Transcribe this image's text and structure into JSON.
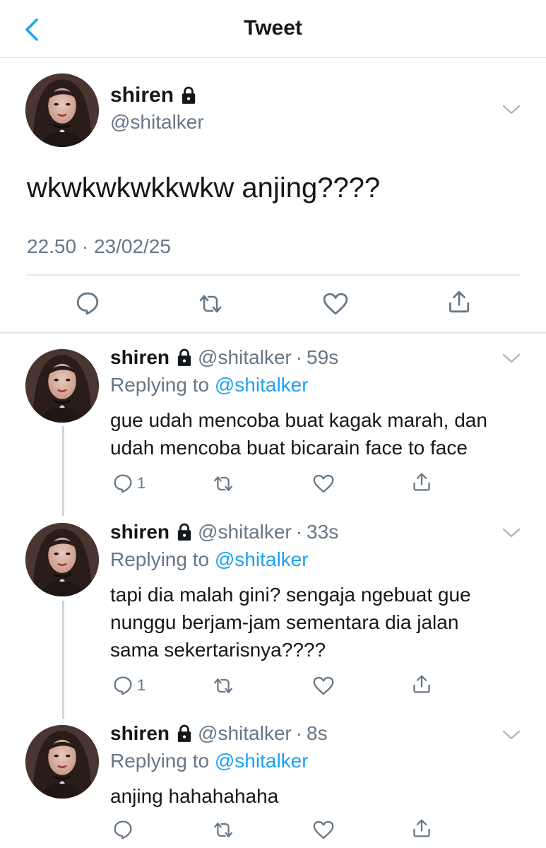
{
  "header": {
    "title": "Tweet"
  },
  "main_tweet": {
    "name": "shiren",
    "handle": "@shitalker",
    "text": "wkwkwkwkkwkw anjing????",
    "timestamp": "22.50 · 23/02/25"
  },
  "replies": [
    {
      "name": "shiren",
      "handle": "@shitalker",
      "separator": "·",
      "age": "59s",
      "replying_prefix": "Replying to ",
      "replying_to": "@shitalker",
      "text": "gue udah mencoba buat kagak marah, dan\nudah mencoba buat bicarain face to face",
      "reply_count": "1"
    },
    {
      "name": "shiren",
      "handle": "@shitalker",
      "separator": "·",
      "age": "33s",
      "replying_prefix": "Replying to ",
      "replying_to": "@shitalker",
      "text": "tapi dia malah gini? sengaja ngebuat gue\nnunggu berjam-jam sementara dia jalan\nsama sekertarisnya????",
      "reply_count": "1"
    },
    {
      "name": "shiren",
      "handle": "@shitalker",
      "separator": "·",
      "age": "8s",
      "replying_prefix": "Replying to ",
      "replying_to": "@shitalker",
      "text": "anjing hahahahaha",
      "reply_count": ""
    }
  ],
  "icons": {
    "back": "chevron-left-icon",
    "lock": "lock-icon",
    "more": "chevron-down-icon",
    "reply": "comment-icon",
    "retweet": "retweet-icon",
    "like": "heart-icon",
    "share": "share-icon"
  },
  "colors": {
    "accent": "#1da1f2",
    "secondary_text": "#657786",
    "divider": "#e1e8ed",
    "thread_line": "#ccd6dd"
  }
}
